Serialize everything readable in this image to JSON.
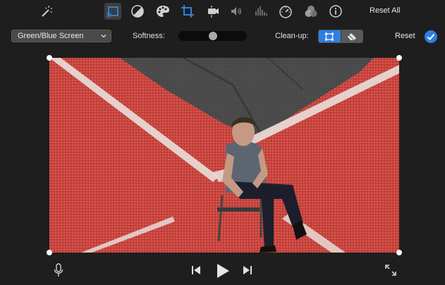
{
  "toolbar": {
    "icons": [
      {
        "name": "magic-wand-icon",
        "selected": false
      },
      {
        "name": "overlay-settings-icon",
        "selected": true
      },
      {
        "name": "color-balance-icon",
        "selected": false
      },
      {
        "name": "color-palette-icon",
        "selected": false
      },
      {
        "name": "crop-icon",
        "selected": false
      },
      {
        "name": "stabilization-icon",
        "selected": false
      },
      {
        "name": "volume-icon",
        "selected": false
      },
      {
        "name": "noise-reduction-icon",
        "selected": false
      },
      {
        "name": "speed-icon",
        "selected": false
      },
      {
        "name": "filter-icon",
        "selected": false
      },
      {
        "name": "info-icon",
        "selected": false
      }
    ],
    "reset_all_label": "Reset All"
  },
  "options": {
    "overlay_mode": "Green/Blue Screen",
    "softness_label": "Softness:",
    "softness_value": 0.5,
    "cleanup_label": "Clean-up:",
    "cleanup_tools": [
      {
        "name": "crop-cleanup-icon",
        "active": true
      },
      {
        "name": "eraser-icon",
        "active": false
      }
    ],
    "reset_label": "Reset",
    "apply_icon": "checkmark-icon",
    "accent_color": "#2f7fe4"
  },
  "viewer": {
    "content": "video-preview"
  },
  "playback": {
    "icons": [
      "microphone-icon",
      "skip-back-icon",
      "play-icon",
      "skip-forward-icon",
      "fullscreen-icon"
    ]
  }
}
